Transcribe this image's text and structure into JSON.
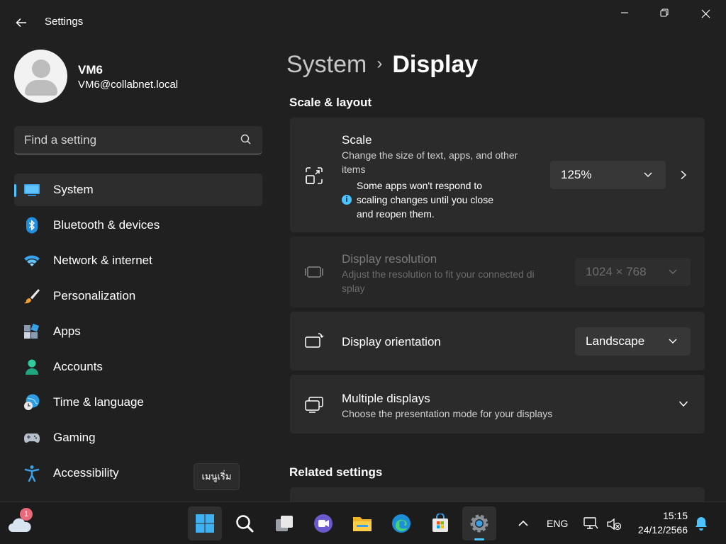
{
  "window": {
    "title": "Settings",
    "back_icon": "arrow-left-icon",
    "minimize_icon": "minimize-icon",
    "maximize_icon": "restore-icon",
    "close_icon": "close-icon"
  },
  "profile": {
    "name": "VM6",
    "email": "VM6@collabnet.local"
  },
  "search": {
    "placeholder": "Find a setting",
    "icon": "search-icon"
  },
  "sidebar": {
    "items": [
      {
        "label": "System",
        "icon": "system-display-icon",
        "active": true
      },
      {
        "label": "Bluetooth & devices",
        "icon": "bluetooth-icon",
        "active": false
      },
      {
        "label": "Network & internet",
        "icon": "wifi-icon",
        "active": false
      },
      {
        "label": "Personalization",
        "icon": "paintbrush-icon",
        "active": false
      },
      {
        "label": "Apps",
        "icon": "apps-icon",
        "active": false
      },
      {
        "label": "Accounts",
        "icon": "person-icon",
        "active": false
      },
      {
        "label": "Time & language",
        "icon": "globe-clock-icon",
        "active": false
      },
      {
        "label": "Gaming",
        "icon": "gamepad-icon",
        "active": false
      },
      {
        "label": "Accessibility",
        "icon": "accessibility-icon",
        "active": false
      }
    ],
    "tooltip": "เมนูเริ่ม"
  },
  "breadcrumb": {
    "parent": "System",
    "separator": "›",
    "current": "Display"
  },
  "sections": {
    "scale_layout": "Scale & layout",
    "related": "Related settings"
  },
  "cards": {
    "scale": {
      "title": "Scale",
      "desc": "Change the size of text, apps, and other items",
      "note": "Some apps won't respond to scaling changes until you close and reopen them.",
      "value": "125%"
    },
    "resolution": {
      "title": "Display resolution",
      "desc": "Adjust the resolution to fit your connected di splay",
      "value": "1024 × 768"
    },
    "orientation": {
      "title": "Display orientation",
      "value": "Landscape"
    },
    "multiple": {
      "title": "Multiple displays",
      "desc": "Choose the presentation mode for your displays"
    }
  },
  "taskbar": {
    "weather_badge": "1",
    "apps": [
      "start-icon",
      "search-icon",
      "task-view-icon",
      "teams-chat-icon",
      "file-explorer-icon",
      "edge-icon",
      "store-icon",
      "settings-icon"
    ],
    "language": "ENG",
    "time": "15:15",
    "date": "24/12/2566"
  },
  "colors": {
    "background": "#202020",
    "card": "#2b2b2b",
    "accent": "#4cc2ff"
  }
}
